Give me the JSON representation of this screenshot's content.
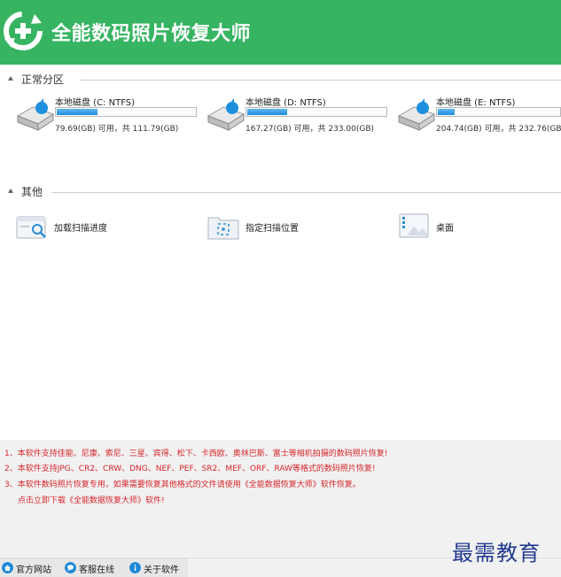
{
  "app": {
    "title": "全能数码照片恢复大师",
    "logo_icon": "recovery-plus-icon"
  },
  "colors": {
    "header_bg": "#36b462",
    "bar_fill": "#1f8edb",
    "note_text": "#d7262c",
    "watermark": "#233a8f"
  },
  "sections": {
    "partitions": {
      "label": "正常分区"
    },
    "others": {
      "label": "其他"
    }
  },
  "drives": [
    {
      "name": "本地磁盘 (C: NTFS)",
      "info": "79.69(GB) 可用，共 111.79(GB)",
      "used_fraction": 0.287
    },
    {
      "name": "本地磁盘 (D: NTFS)",
      "info": "167.27(GB) 可用，共 233.00(GB)",
      "used_fraction": 0.282
    },
    {
      "name": "本地磁盘 (E: NTFS)",
      "info": "204.74(GB) 可用，共 232.76(GB)",
      "used_fraction": 0.12
    }
  ],
  "others": [
    {
      "label": "加载扫描进度",
      "icon": "load-scan-progress-icon"
    },
    {
      "label": "指定扫描位置",
      "icon": "target-folder-icon"
    },
    {
      "label": "桌面",
      "icon": "desktop-icon"
    }
  ],
  "notes": [
    "1、本软件支持佳能、尼康、索尼、三星、宾得、松下、卡西欧、奥林巴斯、富士等相机拍摄的数码照片恢复!",
    "2、本软件支持JPG、CR2、CRW、DNG、NEF、PEF、SR2、MEF、ORF、RAW等格式的数码照片恢复!",
    "3、本软件数码照片恢复专用，如果需要恢复其他格式的文件请使用《全能数据恢复大师》软件恢复。",
    "点击立即下载《全能数据恢复大师》软件!"
  ],
  "footer": {
    "items": [
      {
        "label": "官方网站",
        "icon": "home-icon"
      },
      {
        "label": "客服在线",
        "icon": "chat-icon"
      },
      {
        "label": "关于软件",
        "icon": "info-icon"
      }
    ]
  },
  "watermark": "最需教育"
}
